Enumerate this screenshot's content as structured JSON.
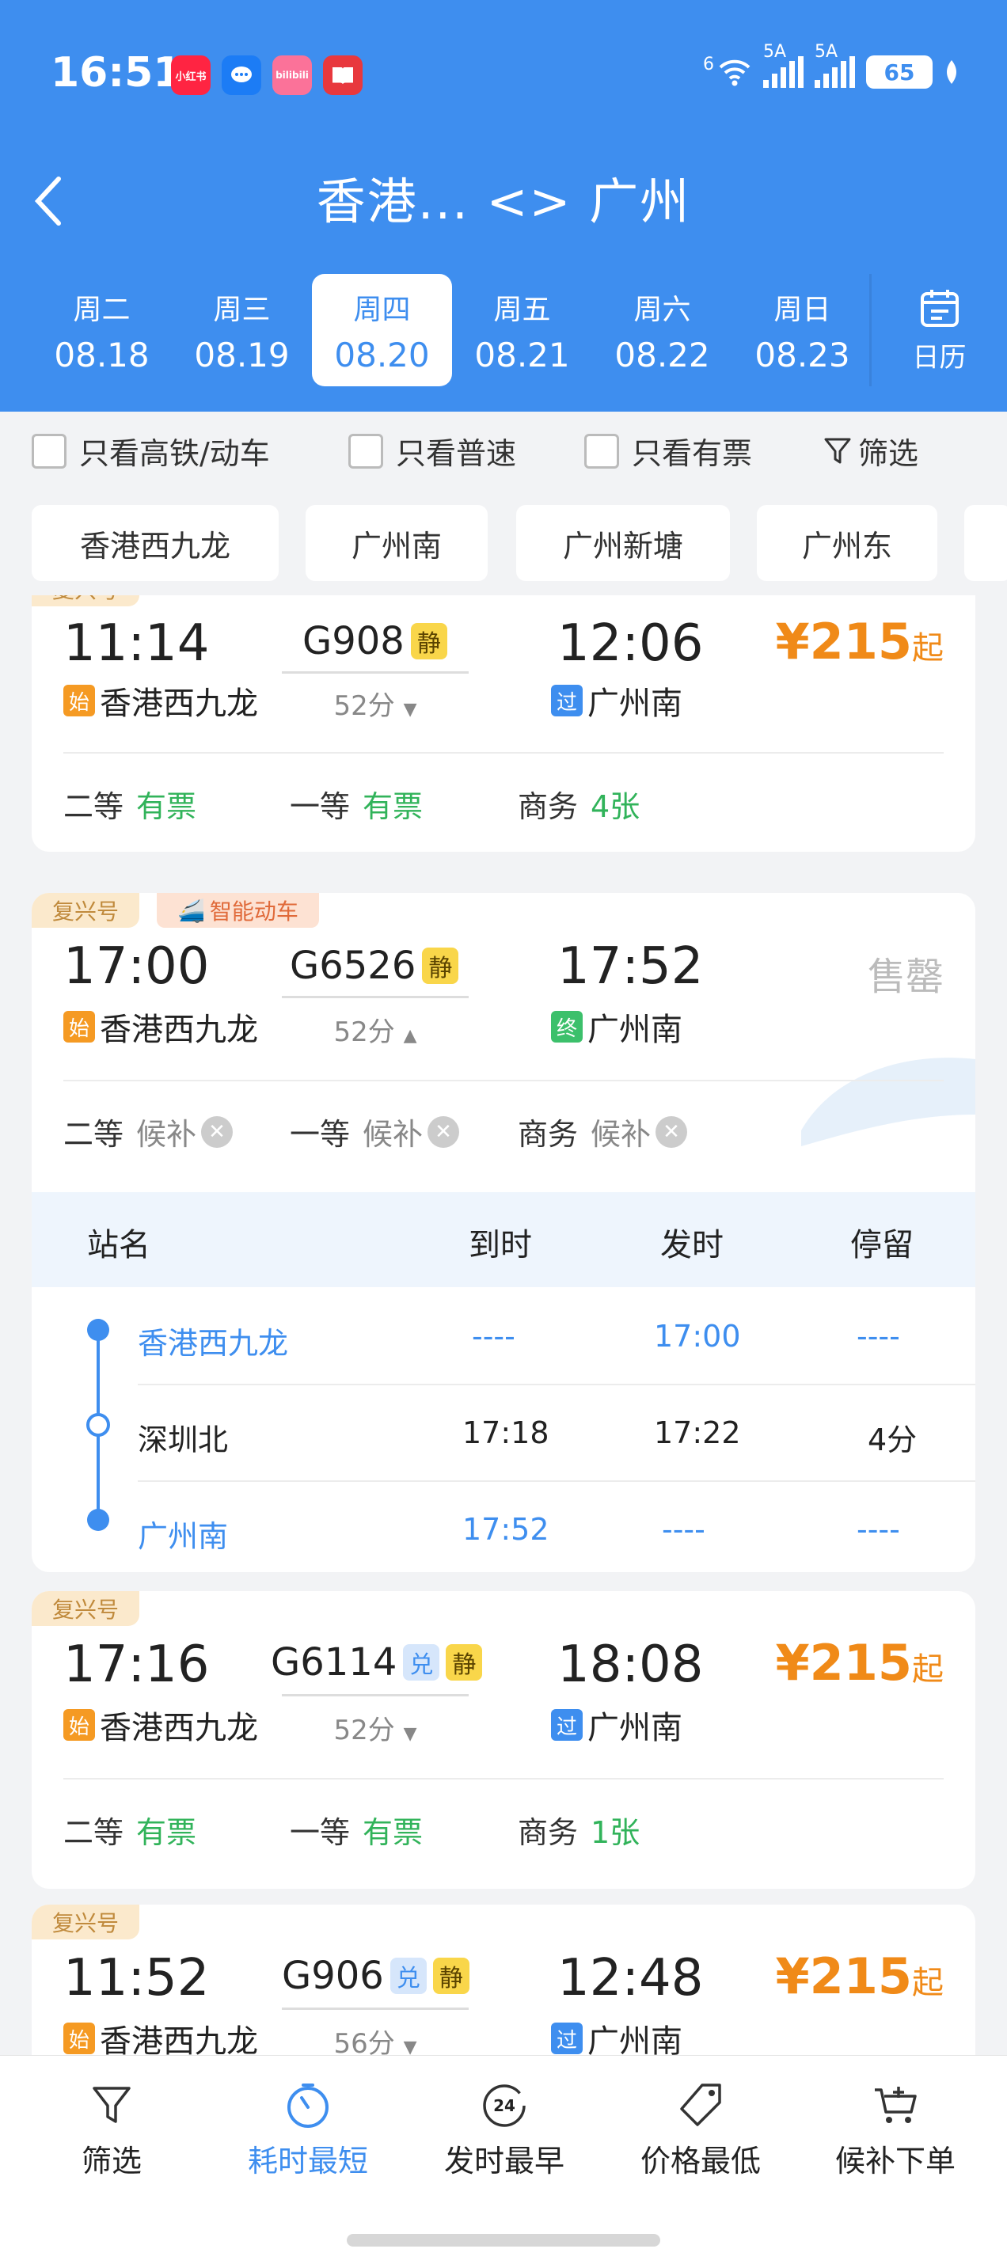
{
  "status_bar": {
    "time": "16:51",
    "battery": "65",
    "net1": "6",
    "sig1": "5A",
    "sig2": "5A",
    "apps": [
      {
        "name": "小红书",
        "color": "#ff2442"
      },
      {
        "name": "chat",
        "color": "#1c7cf5"
      },
      {
        "name": "bilibili",
        "color": "#fb7299"
      },
      {
        "name": "book",
        "color": "#e8383d"
      }
    ]
  },
  "header": {
    "title": "香港... <> 广州",
    "calendar_label": "日历"
  },
  "dates": [
    {
      "week": "周二",
      "date": "08.18"
    },
    {
      "week": "周三",
      "date": "08.19"
    },
    {
      "week": "周四",
      "date": "08.20",
      "selected": true
    },
    {
      "week": "周五",
      "date": "08.21"
    },
    {
      "week": "周六",
      "date": "08.22"
    },
    {
      "week": "周日",
      "date": "08.23"
    }
  ],
  "filters": {
    "high_speed": "只看高铁/动车",
    "normal": "只看普速",
    "available": "只看有票",
    "filter": "筛选"
  },
  "stations": [
    "香港西九龙",
    "广州南",
    "广州新塘",
    "广州东"
  ],
  "trains": [
    {
      "tag": "复兴号",
      "dep": "11:14",
      "no": "G908",
      "arr": "12:06",
      "dur": "52分",
      "from_mark": "始",
      "from": "香港西九龙",
      "to_mark": "过",
      "to": "广州南",
      "price": "¥215",
      "price_suffix": "起",
      "seats": [
        {
          "cls": "二等",
          "val": "有票"
        },
        {
          "cls": "一等",
          "val": "有票"
        },
        {
          "cls": "商务",
          "val": "4张"
        }
      ]
    },
    {
      "tag": "复兴号",
      "tag2": "智能动车",
      "dep": "17:00",
      "no": "G6526",
      "arr": "17:52",
      "dur": "52分",
      "from_mark": "始",
      "from": "香港西九龙",
      "to_mark": "终",
      "to": "广州南",
      "status": "售罄",
      "seats": [
        {
          "cls": "二等",
          "val": "候补"
        },
        {
          "cls": "一等",
          "val": "候补"
        },
        {
          "cls": "商务",
          "val": "候补"
        }
      ],
      "stop_header": {
        "name": "站名",
        "arrive": "到时",
        "depart": "发时",
        "stay": "停留"
      },
      "stops": [
        {
          "name": "香港西九龙",
          "arrive": "----",
          "depart": "17:00",
          "stay": "----"
        },
        {
          "name": "深圳北",
          "arrive": "17:18",
          "depart": "17:22",
          "stay": "4分"
        },
        {
          "name": "广州南",
          "arrive": "17:52",
          "depart": "----",
          "stay": "----"
        }
      ]
    },
    {
      "tag": "复兴号",
      "dep": "17:16",
      "no": "G6114",
      "arr": "18:08",
      "dur": "52分",
      "from_mark": "始",
      "from": "香港西九龙",
      "to_mark": "过",
      "to": "广州南",
      "price": "¥215",
      "price_suffix": "起",
      "seats": [
        {
          "cls": "二等",
          "val": "有票"
        },
        {
          "cls": "一等",
          "val": "有票"
        },
        {
          "cls": "商务",
          "val": "1张"
        }
      ]
    },
    {
      "tag": "复兴号",
      "dep": "11:52",
      "no": "G906",
      "arr": "12:48",
      "dur": "56分",
      "from_mark": "始",
      "from": "香港西九龙",
      "to_mark": "过",
      "to": "广州南",
      "price": "¥215",
      "price_suffix": "起"
    }
  ],
  "badges": {
    "jing": "静",
    "dui": "兑"
  },
  "bottom_nav": [
    {
      "label": "筛选",
      "icon": "funnel-icon"
    },
    {
      "label": "耗时最短",
      "icon": "timer-icon",
      "active": true
    },
    {
      "label": "发时最早",
      "icon": "clock-24-icon",
      "badge": "24"
    },
    {
      "label": "价格最低",
      "icon": "price-tag-icon"
    },
    {
      "label": "候补下单",
      "icon": "cart-icon"
    }
  ],
  "colors": {
    "primary": "#3e8eef",
    "price": "#f08a18",
    "available": "#31b35a"
  }
}
